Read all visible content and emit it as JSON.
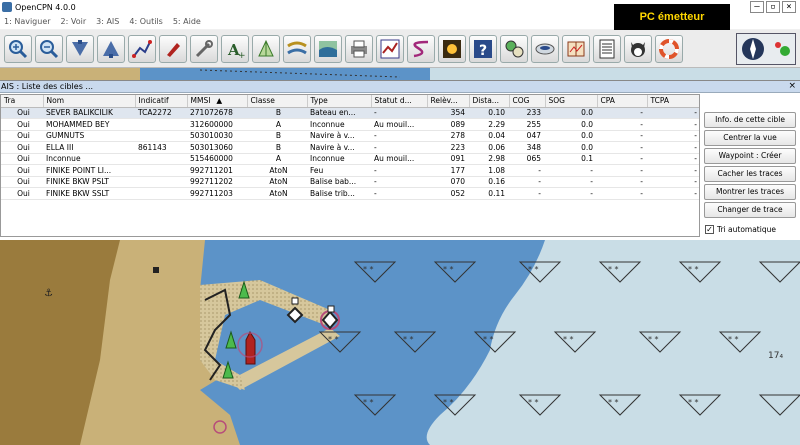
{
  "window": {
    "title": "OpenCPN 4.0.0"
  },
  "menu": [
    "1: Naviguer",
    "2: Voir",
    "3: AIS",
    "4: Outils",
    "5: Aide"
  ],
  "banner": {
    "text": "PC émetteur"
  },
  "toolbar": {
    "tools": [
      "zoom-in-icon",
      "zoom-out-icon",
      "scale-in-icon",
      "scale-out-icon",
      "route-icon",
      "ais-boat-icon",
      "settings-wrench-icon",
      "text-icon",
      "tide-icon",
      "current-icon",
      "chart-icon",
      "print-icon",
      "track-icon",
      "leg-icon",
      "colors-icon",
      "help-icon",
      "dashboard-icon",
      "satellite-icon",
      "chart-book-icon",
      "list-icon",
      "dog-icon",
      "lifebuoy-icon"
    ]
  },
  "ais": {
    "title": "AIS : Liste des cibles ...",
    "columns": [
      "Tra",
      "Nom",
      "Indicatif",
      "MMSI",
      "Classe",
      "Type",
      "Statut d...",
      "Relèv...",
      "Dista...",
      "COG",
      "SOG",
      "CPA",
      "TCPA"
    ],
    "rows": [
      [
        "Oui",
        "SEVER BALIKCILIK",
        "TCA2272",
        "271072678",
        "B",
        "Bateau en...",
        "-",
        "354",
        "0.10",
        "233",
        "0.0",
        "-",
        "-"
      ],
      [
        "Oui",
        "MOHAMMED BEY",
        "",
        "312600000",
        "A",
        "Inconnue",
        "Au mouil...",
        "089",
        "2.29",
        "255",
        "0.0",
        "-",
        "-"
      ],
      [
        "Oui",
        "GUMNUTS",
        "",
        "503010030",
        "B",
        "Navire à v...",
        "-",
        "278",
        "0.04",
        "047",
        "0.0",
        "-",
        "-"
      ],
      [
        "Oui",
        "ELLA III",
        "861143",
        "503013060",
        "B",
        "Navire à v...",
        "-",
        "223",
        "0.06",
        "348",
        "0.0",
        "-",
        "-"
      ],
      [
        "Oui",
        "Inconnue",
        "",
        "515460000",
        "A",
        "Inconnue",
        "Au mouil...",
        "091",
        "2.98",
        "065",
        "0.1",
        "-",
        "-"
      ],
      [
        "Oui",
        "FINIKE POINT LI...",
        "",
        "992711201",
        "AtoN",
        "Feu",
        "-",
        "177",
        "1.08",
        "-",
        "-",
        "-",
        "-"
      ],
      [
        "Oui",
        "FINIKE BKW PSLT",
        "",
        "992711202",
        "AtoN",
        "Balise bab...",
        "-",
        "070",
        "0.16",
        "-",
        "-",
        "-",
        "-"
      ],
      [
        "Oui",
        "FINIKE BKW SSLT",
        "",
        "992711203",
        "AtoN",
        "Balise trib...",
        "-",
        "052",
        "0.11",
        "-",
        "-",
        "-",
        "-"
      ]
    ],
    "buttons": {
      "info": "Info. de cette cible",
      "center": "Centrer la vue",
      "waypoint": "Waypoint : Créer",
      "hide_tracks": "Cacher les traces",
      "show_tracks": "Montrer les traces",
      "change_track": "Changer de trace"
    },
    "auto_sort": {
      "label": "Tri automatique",
      "checked": true
    },
    "sort_indicator": "▲"
  },
  "chart": {
    "sounding_label": "17₄",
    "colors": {
      "deep_water": "#c9dde6",
      "shallow_water": "#5c93c8",
      "land": "#c9b178",
      "sand": "#d6c79c"
    }
  }
}
